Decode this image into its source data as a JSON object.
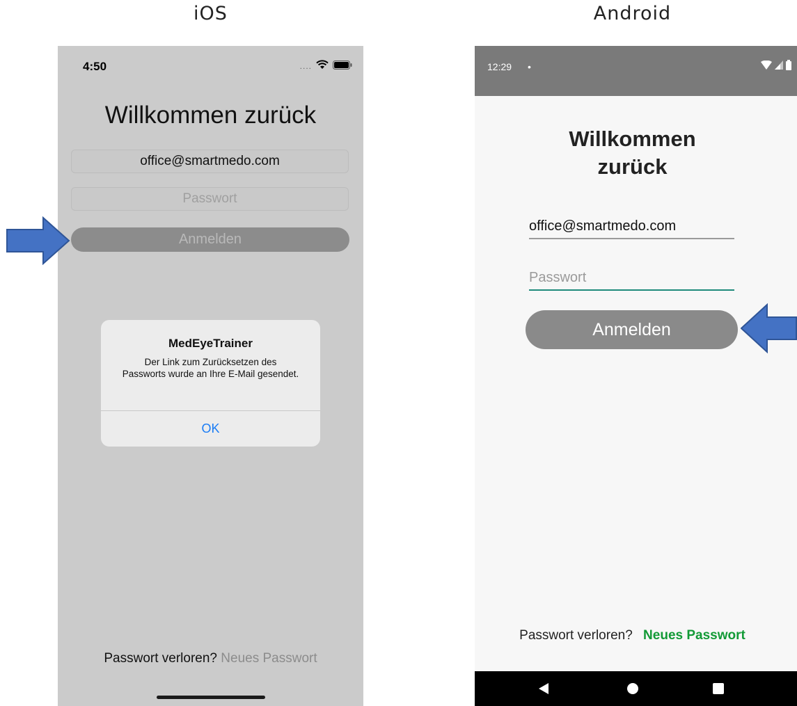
{
  "headings": {
    "ios": "iOS",
    "android": "Android"
  },
  "ios": {
    "status_time": "4:50",
    "title": "Willkommen zurück",
    "email_value": "office@smartmedo.com",
    "password_placeholder": "Passwort",
    "login_button": "Anmelden",
    "alert": {
      "title": "MedEyeTrainer",
      "message": "Der Link zum Zurücksetzen des Passworts wurde an Ihre E-Mail gesendet.",
      "ok": "OK"
    },
    "footer_text": "Passwort verloren?",
    "footer_link": "Neues Passwort"
  },
  "android": {
    "status_time": "12:29",
    "status_dot": "•",
    "title_line1": "Willkommen",
    "title_line2": "zurück",
    "email_value": "office@smartmedo.com",
    "password_placeholder": "Passwort",
    "login_button": "Anmelden",
    "footer_text": "Passwort verloren?",
    "footer_link": "Neues Passwort"
  },
  "icons": {
    "ios_status": [
      "signal-dots-icon",
      "wifi-icon",
      "battery-icon"
    ],
    "android_status": [
      "wifi-icon",
      "cell-signal-icon",
      "battery-icon"
    ],
    "android_nav": [
      "back-icon",
      "home-icon",
      "recents-icon"
    ],
    "annotations": [
      "arrow-right-icon",
      "arrow-left-icon"
    ]
  },
  "colors": {
    "ios_link": "#8c8c8c",
    "ios_alert_ok": "#1a7cf5",
    "android_link": "#129a36",
    "android_focus_underline": "#1e8a7a",
    "annotation_arrow": "#4472c4"
  }
}
